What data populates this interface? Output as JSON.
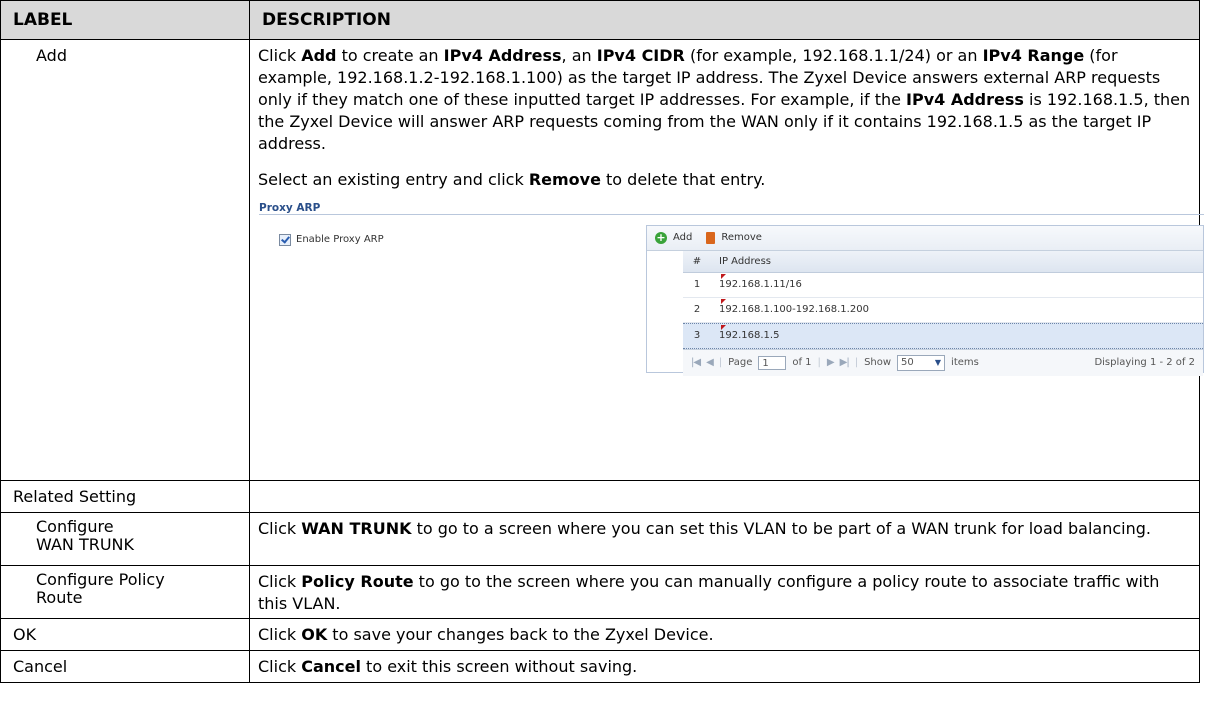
{
  "header": {
    "label": "LABEL",
    "description": "DESCRIPTION"
  },
  "add_row": {
    "label": "Add",
    "p1": [
      {
        "t": "Click ",
        "b": false
      },
      {
        "t": "Add",
        "b": true
      },
      {
        "t": " to create an ",
        "b": false
      },
      {
        "t": "IPv4 Address",
        "b": true
      },
      {
        "t": ", an ",
        "b": false
      },
      {
        "t": "IPv4 CIDR",
        "b": true
      },
      {
        "t": " (for example, 192.168.1.1/24) or an ",
        "b": false
      },
      {
        "t": "IPv4 Range",
        "b": true
      },
      {
        "t": " (for example, 192.168.1.2-192.168.1.100) as the target IP address. The Zyxel Device answers external ARP requests only if they match one of these inputted target IP addresses. For example, if the ",
        "b": false
      },
      {
        "t": "IPv4 Address",
        "b": true
      },
      {
        "t": " is 192.168.1.5, then the Zyxel Device will answer ARP requests coming from the WAN only if it contains 192.168.1.5 as the target IP address.",
        "b": false
      }
    ],
    "p2_pre": "Select an existing entry and click ",
    "p2_bold": "Remove",
    "p2_post": " to delete that entry."
  },
  "screenshot": {
    "section_title": "Proxy ARP",
    "checkbox_label": "Enable Proxy ARP",
    "add_label": "Add",
    "remove_label": "Remove",
    "col_num": "#",
    "col_ip": "IP Address",
    "rows": [
      {
        "n": "1",
        "ip": "192.168.1.11/16"
      },
      {
        "n": "2",
        "ip": "192.168.1.100-192.168.1.200"
      },
      {
        "n": "3",
        "ip": "192.168.1.5"
      }
    ],
    "pager": {
      "page_label": "Page",
      "page_value": "1",
      "of": "of 1",
      "show": "Show",
      "show_value": "50",
      "items": "items",
      "displaying": "Displaying 1 - 2 of 2"
    }
  },
  "related": {
    "label": "Related Setting"
  },
  "wan": {
    "label": "Configure WAN TRUNK",
    "pre": "Click ",
    "bold": "WAN TRUNK",
    "post": " to go to a screen where you can set this VLAN to be part of a WAN trunk for load balancing."
  },
  "policy": {
    "label": "Configure Policy Route",
    "pre": "Click ",
    "bold": "Policy Route",
    "post": " to go to the screen where you can manually configure a policy route to associate traffic with this VLAN."
  },
  "ok": {
    "label": "OK",
    "pre": "Click ",
    "bold": "OK",
    "post": " to save your changes back to the Zyxel Device."
  },
  "cancel": {
    "label": "Cancel",
    "pre": "Click ",
    "bold": "Cancel",
    "post": " to exit this screen without saving."
  }
}
